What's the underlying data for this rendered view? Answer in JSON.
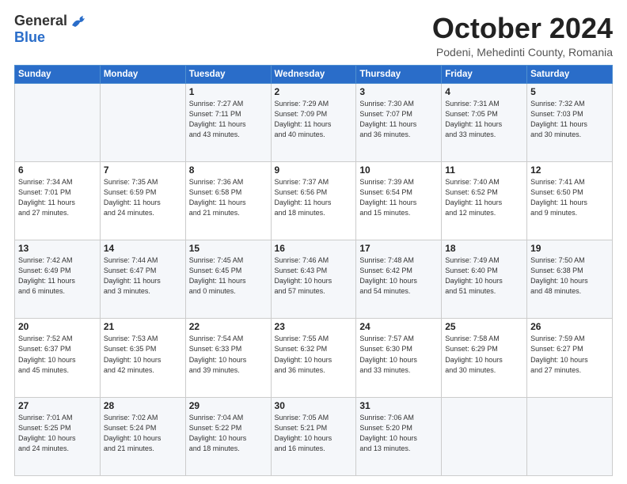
{
  "logo": {
    "general": "General",
    "blue": "Blue"
  },
  "header": {
    "month": "October 2024",
    "location": "Podeni, Mehedinti County, Romania"
  },
  "weekdays": [
    "Sunday",
    "Monday",
    "Tuesday",
    "Wednesday",
    "Thursday",
    "Friday",
    "Saturday"
  ],
  "weeks": [
    [
      {
        "day": "",
        "text": ""
      },
      {
        "day": "",
        "text": ""
      },
      {
        "day": "1",
        "text": "Sunrise: 7:27 AM\nSunset: 7:11 PM\nDaylight: 11 hours\nand 43 minutes."
      },
      {
        "day": "2",
        "text": "Sunrise: 7:29 AM\nSunset: 7:09 PM\nDaylight: 11 hours\nand 40 minutes."
      },
      {
        "day": "3",
        "text": "Sunrise: 7:30 AM\nSunset: 7:07 PM\nDaylight: 11 hours\nand 36 minutes."
      },
      {
        "day": "4",
        "text": "Sunrise: 7:31 AM\nSunset: 7:05 PM\nDaylight: 11 hours\nand 33 minutes."
      },
      {
        "day": "5",
        "text": "Sunrise: 7:32 AM\nSunset: 7:03 PM\nDaylight: 11 hours\nand 30 minutes."
      }
    ],
    [
      {
        "day": "6",
        "text": "Sunrise: 7:34 AM\nSunset: 7:01 PM\nDaylight: 11 hours\nand 27 minutes."
      },
      {
        "day": "7",
        "text": "Sunrise: 7:35 AM\nSunset: 6:59 PM\nDaylight: 11 hours\nand 24 minutes."
      },
      {
        "day": "8",
        "text": "Sunrise: 7:36 AM\nSunset: 6:58 PM\nDaylight: 11 hours\nand 21 minutes."
      },
      {
        "day": "9",
        "text": "Sunrise: 7:37 AM\nSunset: 6:56 PM\nDaylight: 11 hours\nand 18 minutes."
      },
      {
        "day": "10",
        "text": "Sunrise: 7:39 AM\nSunset: 6:54 PM\nDaylight: 11 hours\nand 15 minutes."
      },
      {
        "day": "11",
        "text": "Sunrise: 7:40 AM\nSunset: 6:52 PM\nDaylight: 11 hours\nand 12 minutes."
      },
      {
        "day": "12",
        "text": "Sunrise: 7:41 AM\nSunset: 6:50 PM\nDaylight: 11 hours\nand 9 minutes."
      }
    ],
    [
      {
        "day": "13",
        "text": "Sunrise: 7:42 AM\nSunset: 6:49 PM\nDaylight: 11 hours\nand 6 minutes."
      },
      {
        "day": "14",
        "text": "Sunrise: 7:44 AM\nSunset: 6:47 PM\nDaylight: 11 hours\nand 3 minutes."
      },
      {
        "day": "15",
        "text": "Sunrise: 7:45 AM\nSunset: 6:45 PM\nDaylight: 11 hours\nand 0 minutes."
      },
      {
        "day": "16",
        "text": "Sunrise: 7:46 AM\nSunset: 6:43 PM\nDaylight: 10 hours\nand 57 minutes."
      },
      {
        "day": "17",
        "text": "Sunrise: 7:48 AM\nSunset: 6:42 PM\nDaylight: 10 hours\nand 54 minutes."
      },
      {
        "day": "18",
        "text": "Sunrise: 7:49 AM\nSunset: 6:40 PM\nDaylight: 10 hours\nand 51 minutes."
      },
      {
        "day": "19",
        "text": "Sunrise: 7:50 AM\nSunset: 6:38 PM\nDaylight: 10 hours\nand 48 minutes."
      }
    ],
    [
      {
        "day": "20",
        "text": "Sunrise: 7:52 AM\nSunset: 6:37 PM\nDaylight: 10 hours\nand 45 minutes."
      },
      {
        "day": "21",
        "text": "Sunrise: 7:53 AM\nSunset: 6:35 PM\nDaylight: 10 hours\nand 42 minutes."
      },
      {
        "day": "22",
        "text": "Sunrise: 7:54 AM\nSunset: 6:33 PM\nDaylight: 10 hours\nand 39 minutes."
      },
      {
        "day": "23",
        "text": "Sunrise: 7:55 AM\nSunset: 6:32 PM\nDaylight: 10 hours\nand 36 minutes."
      },
      {
        "day": "24",
        "text": "Sunrise: 7:57 AM\nSunset: 6:30 PM\nDaylight: 10 hours\nand 33 minutes."
      },
      {
        "day": "25",
        "text": "Sunrise: 7:58 AM\nSunset: 6:29 PM\nDaylight: 10 hours\nand 30 minutes."
      },
      {
        "day": "26",
        "text": "Sunrise: 7:59 AM\nSunset: 6:27 PM\nDaylight: 10 hours\nand 27 minutes."
      }
    ],
    [
      {
        "day": "27",
        "text": "Sunrise: 7:01 AM\nSunset: 5:25 PM\nDaylight: 10 hours\nand 24 minutes."
      },
      {
        "day": "28",
        "text": "Sunrise: 7:02 AM\nSunset: 5:24 PM\nDaylight: 10 hours\nand 21 minutes."
      },
      {
        "day": "29",
        "text": "Sunrise: 7:04 AM\nSunset: 5:22 PM\nDaylight: 10 hours\nand 18 minutes."
      },
      {
        "day": "30",
        "text": "Sunrise: 7:05 AM\nSunset: 5:21 PM\nDaylight: 10 hours\nand 16 minutes."
      },
      {
        "day": "31",
        "text": "Sunrise: 7:06 AM\nSunset: 5:20 PM\nDaylight: 10 hours\nand 13 minutes."
      },
      {
        "day": "",
        "text": ""
      },
      {
        "day": "",
        "text": ""
      }
    ]
  ]
}
